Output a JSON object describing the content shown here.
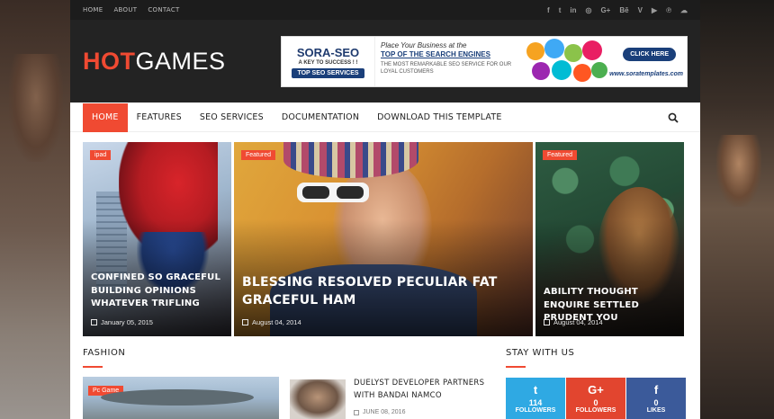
{
  "topbar": {
    "links": [
      "HOME",
      "ABOUT",
      "CONTACT"
    ],
    "social": [
      {
        "icon": "facebook-icon",
        "glyph": "f"
      },
      {
        "icon": "twitter-icon",
        "glyph": "t"
      },
      {
        "icon": "linkedin-icon",
        "glyph": "in"
      },
      {
        "icon": "instagram-icon",
        "glyph": "◎"
      },
      {
        "icon": "google-plus-icon",
        "glyph": "G+"
      },
      {
        "icon": "behance-icon",
        "glyph": "Bē"
      },
      {
        "icon": "vine-icon",
        "glyph": "V"
      },
      {
        "icon": "youtube-icon",
        "glyph": "▶"
      },
      {
        "icon": "pinterest-icon",
        "glyph": "℗"
      },
      {
        "icon": "soundcloud-icon",
        "glyph": "☁"
      }
    ]
  },
  "header": {
    "logo_hot": "HOT",
    "logo_games": "GAMES",
    "banner": {
      "title": "SORA-SEO",
      "tagline": "A KEY TO SUCCESS ! !",
      "button": "TOP SEO SERVICES",
      "line1": "Place Your Business at the",
      "line2": "TOP OF THE SEARCH ENGINES",
      "line3": "THE MOST REMARKABLE SEO SERVICE FOR OUR LOYAL CUSTOMERS",
      "cta": "CLICK HERE",
      "url": "www.soratemplates.com"
    }
  },
  "nav": {
    "items": [
      "HOME",
      "FEATURES",
      "SEO SERVICES",
      "DOCUMENTATION",
      "DOWNLOAD THIS TEMPLATE"
    ]
  },
  "hero": [
    {
      "badge": "ipad",
      "title": "CONFINED SO GRACEFUL BUILDING OPINIONS WHATEVER TRIFLING",
      "date": "January 05, 2015"
    },
    {
      "badge": "Featured",
      "title": "BLESSING RESOLVED PECULIAR FAT GRACEFUL HAM",
      "date": "August 04, 2014"
    },
    {
      "badge": "Featured",
      "title": "ABILITY THOUGHT ENQUIRE SETTLED PRUDENT YOU",
      "date": "August 04, 2014"
    }
  ],
  "fashion": {
    "title": "FASHION",
    "big_badge": "Pc Game",
    "post_title": "DUELYST DEVELOPER PARTNERS WITH BANDAI NAMCO",
    "post_date": "JUNE 08, 2016"
  },
  "stay": {
    "title": "STAY WITH US",
    "stats": [
      {
        "glyph": "t",
        "count": "114",
        "label": "FOLLOWERS"
      },
      {
        "glyph": "G+",
        "count": "0",
        "label": "FOLLOWERS"
      },
      {
        "glyph": "f",
        "count": "0",
        "label": "LIKES"
      }
    ]
  },
  "colors": {
    "accent": "#f04a32",
    "twitter": "#2fa9e3",
    "google": "#e2452f",
    "facebook": "#3b5a9a"
  }
}
